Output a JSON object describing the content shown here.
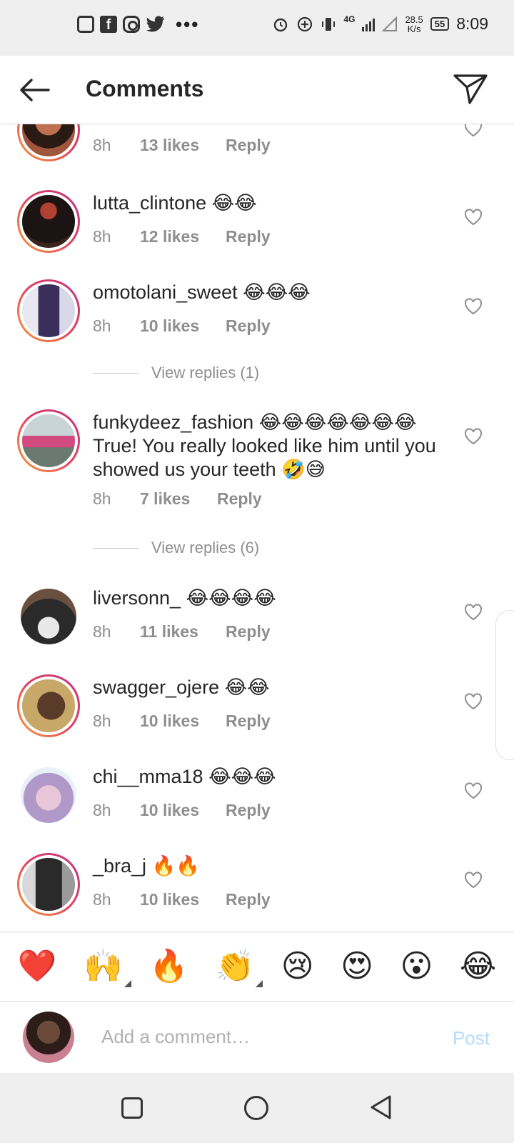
{
  "status_bar": {
    "net_speed": "28.5",
    "net_unit": "K/s",
    "network": "4G",
    "battery": "55",
    "time": "8:09"
  },
  "header": {
    "title": "Comments"
  },
  "comments": [
    {
      "username": "",
      "text": "",
      "time": "8h",
      "likes": "13 likes",
      "reply": "Reply",
      "avatar_color": "#a0553d"
    },
    {
      "username": "lutta_clintone",
      "text": " 😂😂",
      "time": "8h",
      "likes": "12 likes",
      "reply": "Reply",
      "avatar_color": "#3a2420"
    },
    {
      "username": "omotolani_sweet",
      "text": " 😂😂😂",
      "time": "8h",
      "likes": "10 likes",
      "reply": "Reply",
      "avatar_color": "#5a4a7a"
    },
    {
      "username": "funkydeez_fashion",
      "text": " 😂😂😂😂😂😂😂 True! You really looked like him until you showed us your teeth 🤣😅",
      "time": "8h",
      "likes": "7 likes",
      "reply": "Reply",
      "avatar_color": "#8a9a9a"
    },
    {
      "username": "liversonn_",
      "text": " 😂😂😂😂",
      "time": "8h",
      "likes": "11 likes",
      "reply": "Reply",
      "avatar_color": "#2a2a2a"
    },
    {
      "username": "swagger_ojere",
      "text": " 😂😂",
      "time": "8h",
      "likes": "10 likes",
      "reply": "Reply",
      "avatar_color": "#b08a50"
    },
    {
      "username": "chi__mma18",
      "text": " 😂😂😂",
      "time": "8h",
      "likes": "10 likes",
      "reply": "Reply",
      "avatar_color": "#c8a8d8"
    },
    {
      "username": "_bra_j",
      "text": " 🔥🔥",
      "time": "8h",
      "likes": "10 likes",
      "reply": "Reply",
      "avatar_color": "#4a4a4a"
    }
  ],
  "view_replies": [
    "View replies (1)",
    "View replies (6)"
  ],
  "emoji_bar": [
    "❤️",
    "🙌",
    "🔥",
    "👏",
    "😢",
    "😍",
    "😮",
    "😂"
  ],
  "composer": {
    "placeholder": "Add a comment…",
    "post_label": "Post"
  }
}
